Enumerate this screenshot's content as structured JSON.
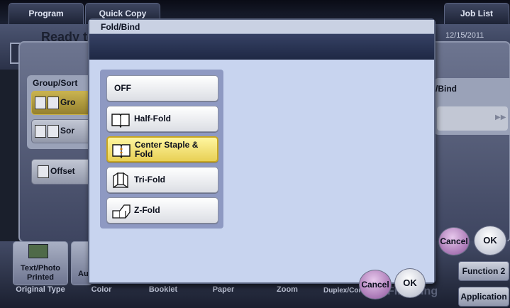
{
  "topbar": {
    "tabs": [
      "Program",
      "Quick Copy"
    ],
    "job_list": "Job List"
  },
  "status": {
    "ready_text": "Ready to",
    "date": "12/15/2011"
  },
  "background": {
    "group_sort_label": "Group/Sort",
    "group_button": "Gro",
    "sort_button": "Sor",
    "offset_button": "Offset",
    "right_panel_label": "/Bind",
    "bottom_tabs": [
      "Original Type",
      "Color",
      "Booklet",
      "Paper",
      "Zoom",
      "Duplex/Combine",
      "Finishing"
    ],
    "thumb_label": "Text/Photo Printed",
    "auto_label": "Aut",
    "function2": "Function 2",
    "application": "Application",
    "cancel": "Cancel",
    "ok": "OK"
  },
  "dialog": {
    "title": "Fold/Bind",
    "options": [
      {
        "label": "OFF",
        "icon": "none"
      },
      {
        "label": "Half-Fold",
        "icon": "half-fold-icon"
      },
      {
        "label": "Center Staple & Fold",
        "icon": "center-staple-fold-icon",
        "selected": true
      },
      {
        "label": "Tri-Fold",
        "icon": "tri-fold-icon"
      },
      {
        "label": "Z-Fold",
        "icon": "z-fold-icon"
      }
    ],
    "cancel_label": "Cancel",
    "ok_label": "OK"
  }
}
